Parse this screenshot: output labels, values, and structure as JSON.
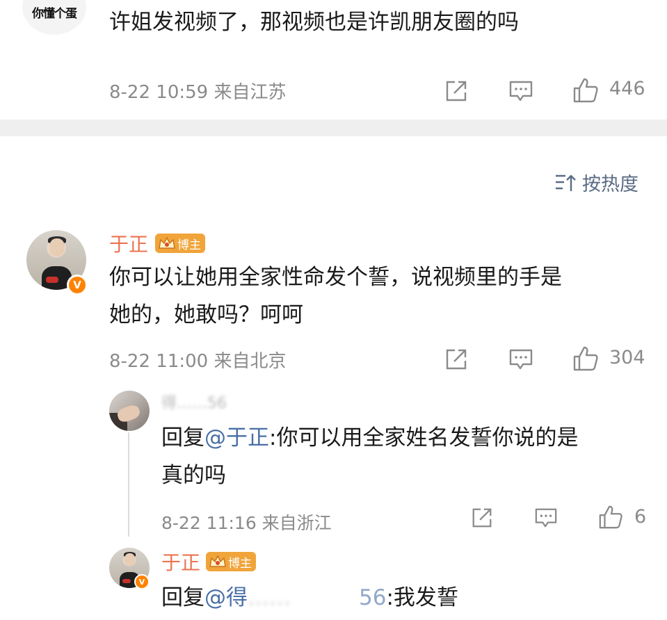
{
  "comment_top": {
    "avatar_text": "你懂个蛋",
    "text": "许姐发视频了，那视频也是许凯朋友圈的吗",
    "meta": "8-22 10:59 来自江苏",
    "likes": "446"
  },
  "sort": {
    "label": "按热度",
    "icon": "sort-icon"
  },
  "comment_main": {
    "username": "于正",
    "badge": "博主",
    "text_line1": "你可以让她用全家性命发个誓，说视频里的手是",
    "text_line2": "她的，她敢吗？呵呵",
    "meta": "8-22 11:00 来自北京",
    "likes": "304",
    "verified": "V"
  },
  "reply_1": {
    "username_blurred": "得……56",
    "reply_prefix": "回复",
    "mention": "@于正",
    "text_line1": ":你可以用全家姓名发誓你说的是",
    "text_line2": "真的吗",
    "meta": "8-22 11:16 来自浙江",
    "likes": "6"
  },
  "reply_2": {
    "username": "于正",
    "badge": "博主",
    "reply_prefix": "回复",
    "mention_visible": "@得",
    "mention_tail": "56",
    "text": ":我发誓",
    "verified": "V"
  },
  "colors": {
    "username": "#eb7350",
    "mention": "#4a6fa5",
    "badge": "#f0a43a",
    "meta": "#8a8a8a",
    "divider": "#efefef"
  }
}
